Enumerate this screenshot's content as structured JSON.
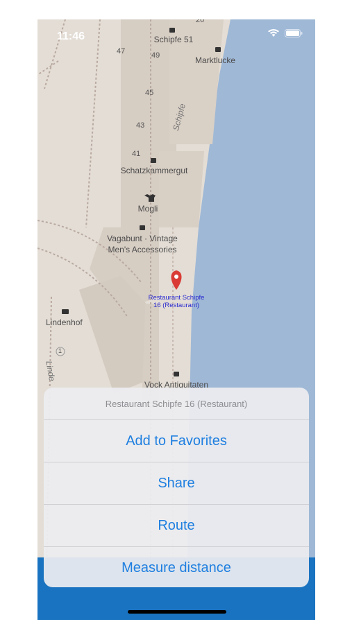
{
  "status": {
    "time": "11:46"
  },
  "map": {
    "labels": {
      "schipfe51": "Schipfe 51",
      "marktlucke": "Marktlucke",
      "schatzkammergut": "Schatzkammergut",
      "mogli": "Mogli",
      "vagabunt_line1": "Vagabunt · Vintage",
      "vagabunt_line2": "Men's Accessories",
      "lindenhof": "Lindenhof",
      "vock": "Vock Antiquitaten",
      "street_schipfe": "Schipfe",
      "street_linde": "Linde"
    },
    "numbers": {
      "n47": "47",
      "n49": "49",
      "n45": "45",
      "n43": "43",
      "n41": "41",
      "n1": "1",
      "n20": "20"
    },
    "selected_poi": {
      "line1": "Restaurant Schipfe",
      "line2": "16 (Restaurant)"
    }
  },
  "action_sheet": {
    "title": "Restaurant Schipfe 16 (Restaurant)",
    "buttons": [
      "Add to Favorites",
      "Share",
      "Route",
      "Measure distance"
    ]
  },
  "colors": {
    "water": "#9fb8d6",
    "land": "#e3ddd5",
    "building": "#d6cdc3",
    "accent": "#1f7fe0",
    "tabbar": "#1a73c0",
    "pin": "#d93b34"
  }
}
